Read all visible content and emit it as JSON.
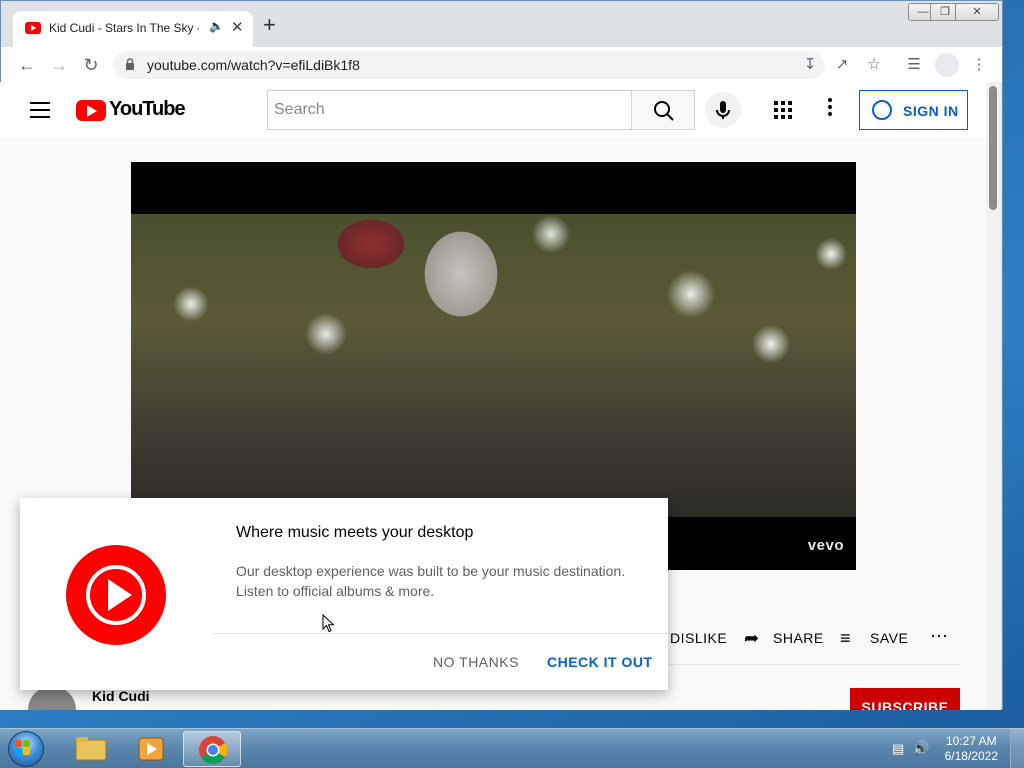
{
  "browser": {
    "tab_title": "Kid Cudi - Stars In The Sky -",
    "tab_audio_icon": "speaker-icon",
    "url": "youtube.com/watch?v=efiLdiBk1f8"
  },
  "youtube": {
    "logo_text": "YouTube",
    "search_placeholder": "Search",
    "sign_in_label": "SIGN IN",
    "vevo_label": "vevo",
    "actions": {
      "dislike": "DISLIKE",
      "share": "SHARE",
      "save": "SAVE"
    },
    "channel_name": "Kid Cudi",
    "subscribe_label": "SUBSCRIBE"
  },
  "dialog": {
    "title": "Where music meets your desktop",
    "body": "Our desktop experience was built to be your music destination. Listen to official albums & more.",
    "no_thanks": "NO THANKS",
    "check_it_out": "CHECK IT OUT"
  },
  "taskbar": {
    "time": "10:27 AM",
    "date": "6/18/2022"
  },
  "colors": {
    "youtube_red": "#ff0000",
    "link_blue": "#065fd4"
  }
}
